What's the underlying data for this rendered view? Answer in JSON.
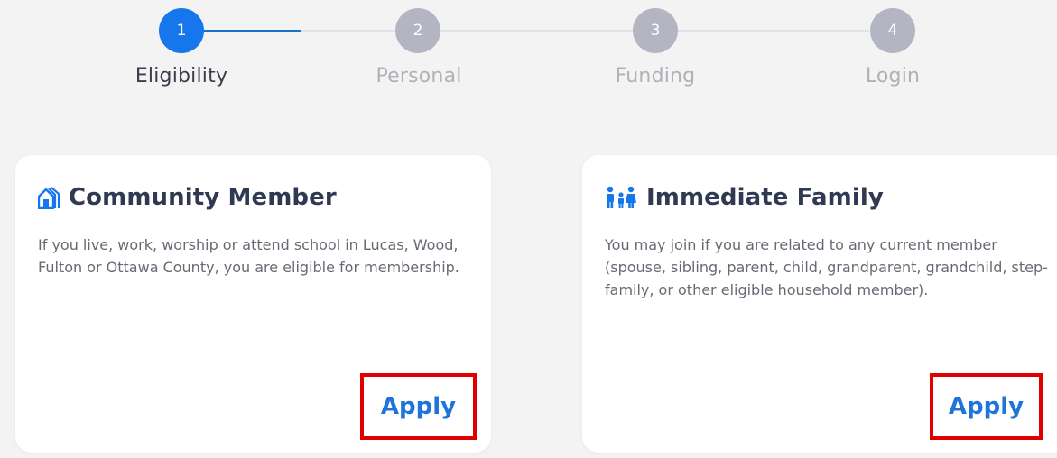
{
  "stepper": {
    "steps": [
      {
        "number": "1",
        "label": "Eligibility",
        "active": true
      },
      {
        "number": "2",
        "label": "Personal",
        "active": false
      },
      {
        "number": "3",
        "label": "Funding",
        "active": false
      },
      {
        "number": "4",
        "label": "Login",
        "active": false
      }
    ]
  },
  "cards": [
    {
      "title": "Community Member",
      "icon": "building-icon",
      "description": "If you live, work, worship or attend school in Lucas, Wood, Fulton or Ottawa County, you are eligible for membership.",
      "button_label": "Apply"
    },
    {
      "title": "Immediate Family",
      "icon": "family-icon",
      "description": "You may join if you are related to any current member (spouse, sibling, parent, child, grandparent, grandchild, step-family, or other eligible household member).",
      "button_label": "Apply"
    }
  ],
  "colors": {
    "accent": "#1677ec",
    "inactive_step": "#b3b5c2",
    "highlight_frame": "#e00000"
  }
}
